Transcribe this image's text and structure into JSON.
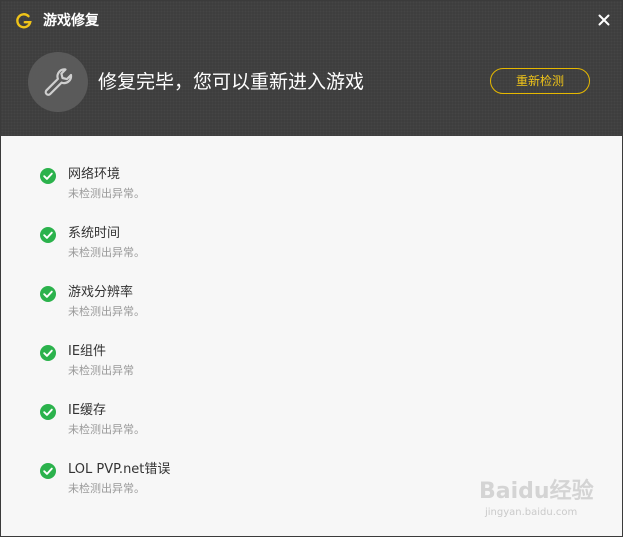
{
  "window": {
    "title": "游戏修复",
    "close_icon": "close-icon",
    "logo_icon": "app-logo-icon"
  },
  "hero": {
    "icon": "wrench-icon",
    "message": "修复完毕，您可以重新进入游戏",
    "recheck_label": "重新检测"
  },
  "checks": [
    {
      "name": "网络环境",
      "status": "未检测出异常。",
      "icon": "check-circle-icon"
    },
    {
      "name": "系统时间",
      "status": "未检测出异常。",
      "icon": "check-circle-icon"
    },
    {
      "name": "游戏分辨率",
      "status": "未检测出异常。",
      "icon": "check-circle-icon"
    },
    {
      "name": "IE组件",
      "status": "未检测出异常",
      "icon": "check-circle-icon"
    },
    {
      "name": "IE缓存",
      "status": "未检测出异常。",
      "icon": "check-circle-icon"
    },
    {
      "name": "LOL PVP.net错误",
      "status": "未检测出异常。",
      "icon": "check-circle-icon"
    }
  ],
  "watermark": {
    "main": "Baidu经验",
    "sub": "jingyan.baidu.com"
  },
  "colors": {
    "header_bg": "#3d3d3d",
    "accent_yellow": "#f0c419",
    "success_green": "#2bb24c",
    "content_bg": "#f7f7f7"
  }
}
